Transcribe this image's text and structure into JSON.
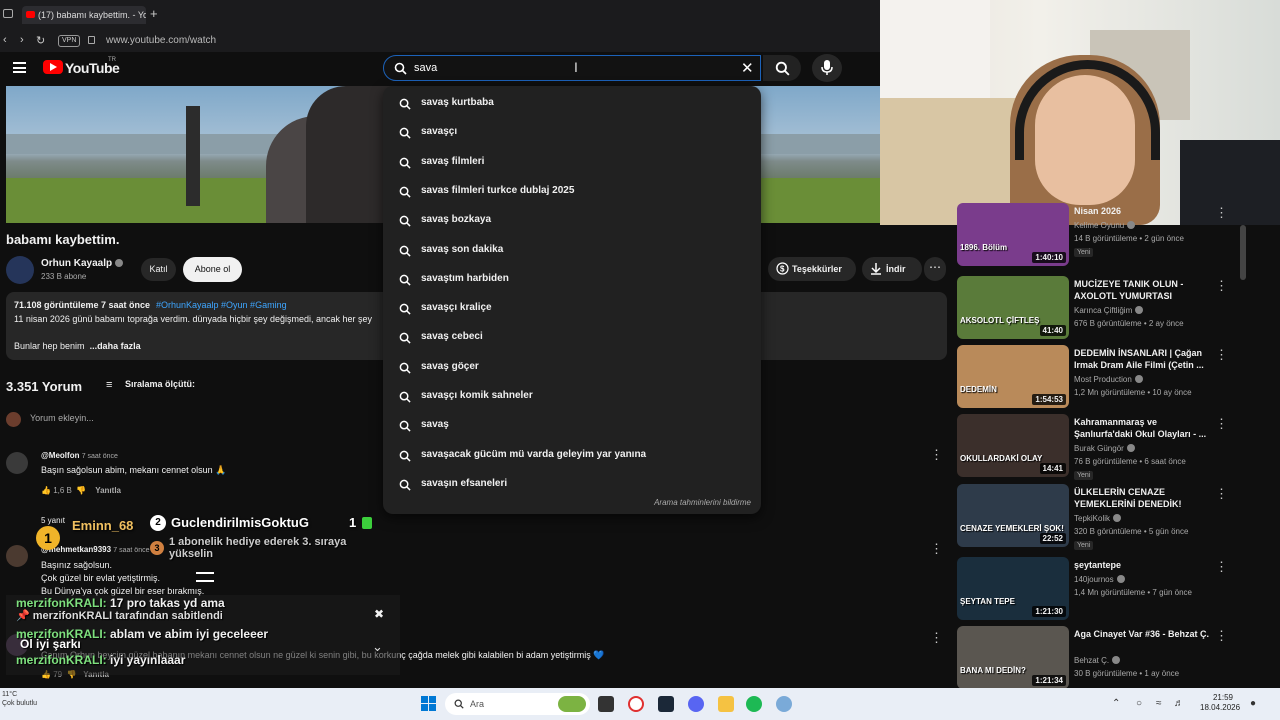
{
  "browser": {
    "tab_title": "(17) babamı kaybettim. - Yo",
    "new_tab": "+",
    "vpn": "VPN",
    "url": "www.youtube.com/watch"
  },
  "youtube": {
    "logo_text": "YouTube",
    "region": "TR",
    "search_value": "sava",
    "suggestions": [
      "savaş kurtbaba",
      "savaşçı",
      "savaş filmleri",
      "savas filmleri turkce dublaj 2025",
      "savaş bozkaya",
      "savaş son dakika",
      "savaştım harbiden",
      "savaşçı kraliçe",
      "savaş cebeci",
      "savaş göçer",
      "savaşçı komik sahneler",
      "savaş",
      "savaşacak gücüm mü varda geleyim yar yanına",
      "savaşın efsaneleri"
    ],
    "report_link": "Arama tahminlerini bildirme"
  },
  "video": {
    "title": "babamı kaybettim.",
    "channel": "Orhun Kayaalp",
    "subscribers": "233 B abone",
    "join": "Katıl",
    "subscribe": "Abone ol",
    "thanks": "Teşekkürler",
    "download": "İndir",
    "more": "⋯",
    "desc_meta": "71.108 görüntüleme  7 saat önce",
    "desc_tags": "#OrhunKayaalp #Oyun #Gaming",
    "desc_text": "11 nisan 2026 günü babamı toprağa verdim. dünyada hiçbir şey değişmedi, ancak her şey",
    "desc_line2": "Bunlar hep benim",
    "desc_more": "...daha fazla"
  },
  "comments": {
    "count": "3.351 Yorum",
    "sort": "Sıralama ölçütü:",
    "add": "Yorum ekleyin...",
    "reply": "Yanıtla",
    "c1": {
      "user": "@Meolfon",
      "time": "7 saat önce",
      "text": "Başın sağolsun abim, mekanı cennet olsun 🙏",
      "likes": "1,6 B"
    },
    "c2": {
      "user": "@mehmetkan9393",
      "time": "7 saat önce",
      "l1": "Başınız sağolsun.",
      "l2": "Çok güzel bir evlat yetiştirmiş.",
      "l3": "Bu Dünya'ya çok güzel bir eser bırakmış.",
      "replies": "5 yanıt"
    },
    "c3": {
      "text": "Canım Orhun beycim güzel babanın mekanı cennet olsun ne güzel ki senin gibi, bu korkunç çağda melek gibi kalabilen bi adam yetiştirmiş 💙",
      "likes": "79"
    }
  },
  "leaderboard": {
    "rank1_name": "Eminn_68",
    "rank2_name": "GuclendirilmisGoktuG",
    "rank2_count": "1",
    "rank3_text": "1 abonelik hediye ederek 3. sıraya yükselin",
    "r1": "1",
    "r2": "2",
    "r3": "3"
  },
  "chat_overlay": {
    "l1_user": "merzifonKRALI:",
    "l1_msg": " 17 pro takas yd ama",
    "l2_msg": "merzifonKRALI tarafından sabitlendi",
    "l3_user": "merzifonKRALI:",
    "l3_msg": " ablam ve abim iyi geceleeer",
    "l4_user": "Ol iyi şarkı",
    "l5_user": "merzifonKRALI:",
    "l5_msg": " iyi yayınlaaar"
  },
  "sidebar": [
    {
      "title": "Nisan 2026",
      "channel": "Kelime Oyunu",
      "meta": "14 B görüntüleme • 2 gün önce",
      "badge": "Yeni",
      "duration": "1:40:10",
      "thumb": "#7a3c8c",
      "tag": "1896. Bölüm"
    },
    {
      "title": "MUCİZEYE TANIK OLUN - AXOLOTL YUMURTASI",
      "channel": "Karınca Çiftliğim",
      "meta": "676 B görüntüleme • 2 ay önce",
      "duration": "41:40",
      "thumb": "#5a7b3a",
      "tag": "AKSOLOTL ÇİFTLEŞ"
    },
    {
      "title": "DEDEMİN İNSANLARI | Çağan Irmak Dram Aile Filmi (Çetin ...",
      "channel": "Most Production",
      "meta": "1,2 Mn görüntüleme • 10 ay önce",
      "duration": "1:54:53",
      "thumb": "#b98a5a",
      "tag": "DEDEMİN"
    },
    {
      "title": "Kahramanmaraş ve Şanlıurfa'daki Okul Olayları - ...",
      "channel": "Burak Güngör",
      "meta": "76 B görüntüleme • 6 saat önce",
      "badge": "Yeni",
      "duration": "14:41",
      "thumb": "#3b2f2b",
      "tag": "OKULLARDAKİ OLAY"
    },
    {
      "title": "ÜLKELERİN CENAZE YEMEKLERİNİ DENEDİK!",
      "channel": "TepkiKolik",
      "meta": "320 B görüntüleme • 5 gün önce",
      "badge": "Yeni",
      "duration": "22:52",
      "thumb": "#2e3b4a",
      "tag": "CENAZE YEMEKLERİ ŞOK!"
    },
    {
      "title": "şeytantepe",
      "channel": "140journos",
      "meta": "1,4 Mn görüntüleme • 7 gün önce",
      "duration": "1:21:30",
      "thumb": "#1a2e3d",
      "tag": "ŞEYTAN TEPE"
    },
    {
      "title": "Aga Cinayet Var #36 - Behzat Ç.",
      "channel": "Behzat Ç.",
      "meta": "30 B görüntüleme • 1 ay önce",
      "duration": "1:21:34",
      "thumb": "#5a5650",
      "tag": "BANA MI DEDİN?"
    }
  ],
  "taskbar": {
    "search": "Ara",
    "weather_temp": "11°C",
    "weather_desc": "Çok bulutlu",
    "time": "21:59",
    "date": "18.04.2026"
  },
  "colors": {
    "accent": "#3ea6ff",
    "brand": "#ff0000",
    "chat_user": "#7ee07e"
  }
}
